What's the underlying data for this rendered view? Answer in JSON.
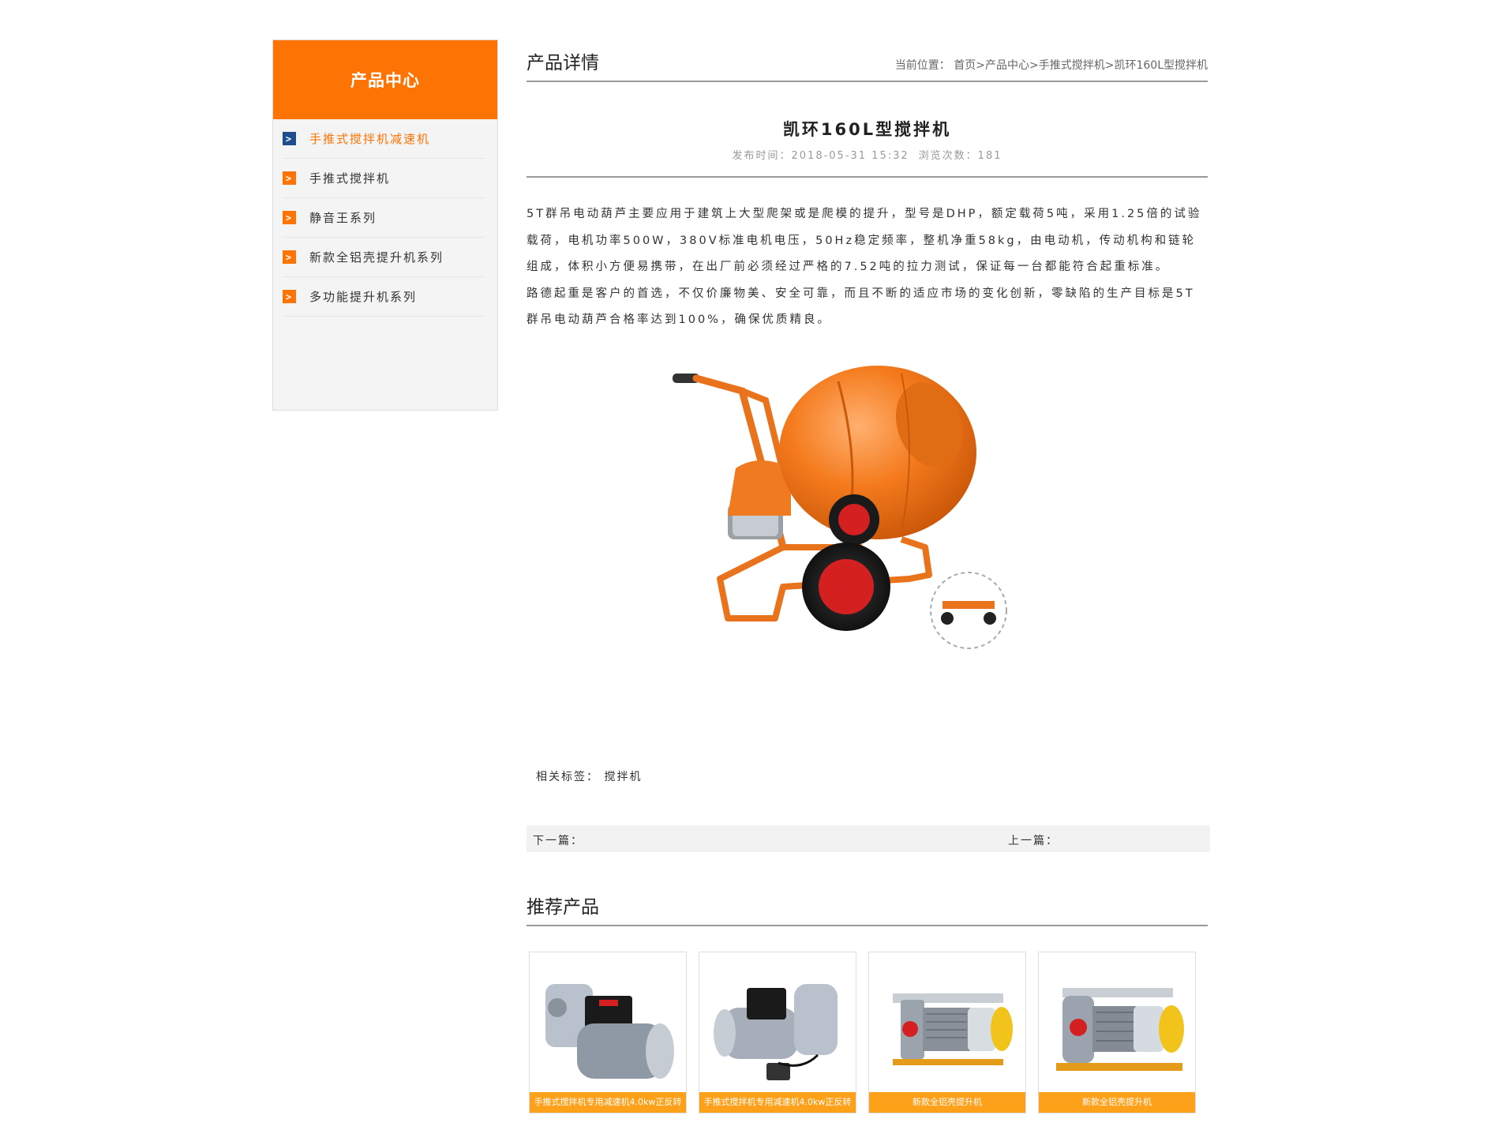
{
  "sidebar": {
    "title": "产品中心",
    "arrow": ">",
    "items": [
      {
        "label": "手推式搅拌机减速机"
      },
      {
        "label": "手推式搅拌机"
      },
      {
        "label": "静音王系列"
      },
      {
        "label": "新款全铝壳提升机系列"
      },
      {
        "label": "多功能提升机系列"
      }
    ]
  },
  "main": {
    "section_title": "产品详情",
    "breadcrumb": {
      "prefix": "当前位置：",
      "home": "首页",
      "sep": ">",
      "center": "产品中心",
      "category": "手推式搅拌机",
      "current": "凯环160L型搅拌机"
    },
    "article": {
      "title": "凯环160L型搅拌机",
      "publish_label": "发布时间：",
      "publish_time": "2018-05-31 15:32",
      "views_label": "浏览次数：",
      "views": "181",
      "paragraph1": "5T群吊电动葫芦主要应用于建筑上大型爬架或是爬模的提升，型号是DHP，额定载荷5吨，采用1.25倍的试验载荷，电机功率500W，380V标准电机电压，50Hz稳定频率，整机净重58kg，由电动机，传动机构和链轮组成，体积小方便易携带，在出厂前必须经过严格的7.52吨的拉力测试，保证每一台都能符合起重标准。",
      "paragraph2": "路德起重是客户的首选，不仅价廉物美、安全可靠，而且不断的适应市场的变化创新，零缺陷的生产目标是5T群吊电动葫芦合格率达到100%，确保优质精良。"
    },
    "tags": {
      "label": "相关标签：",
      "value": "搅拌机"
    },
    "prevnext": {
      "next_label": "下一篇：",
      "prev_label": "上一篇："
    },
    "recommend": {
      "title": "推荐产品",
      "items": [
        {
          "caption": "手推式搅拌机专用减速机4.0kw正反转"
        },
        {
          "caption": "手推式搅拌机专用减速机4.0kw正反转"
        },
        {
          "caption": "新款全铝壳提升机"
        },
        {
          "caption": "新款全铝壳提升机"
        }
      ]
    }
  },
  "colors": {
    "accent": "#fd7405",
    "active_arrow": "#1f4e8c",
    "caption_bg": "#fda01a"
  }
}
